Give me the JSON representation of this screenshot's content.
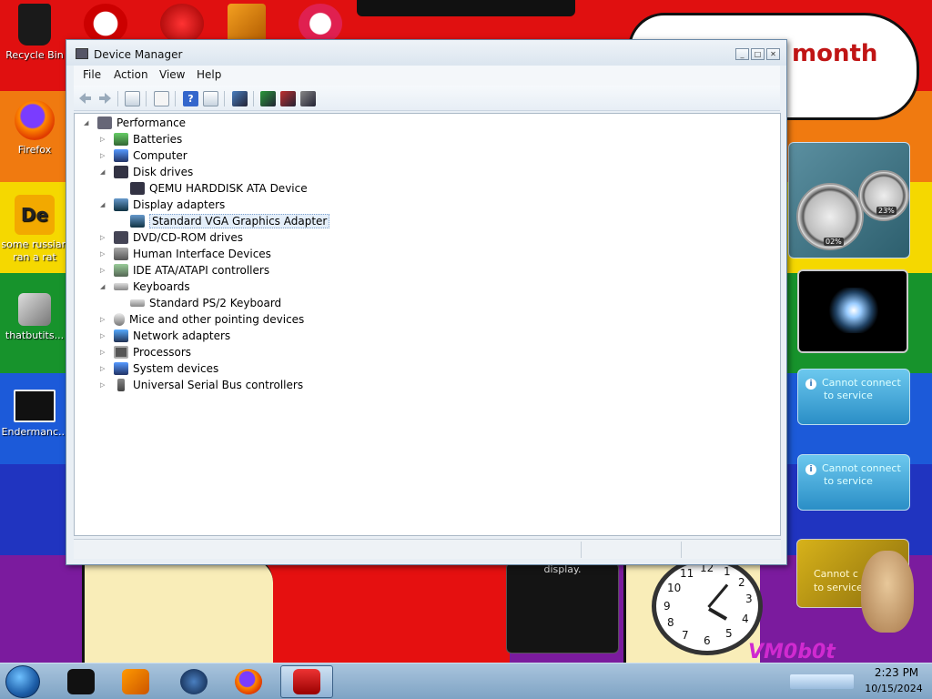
{
  "desktop": {
    "icons": [
      {
        "label": "Recycle Bin"
      },
      {
        "label": "Firefox"
      },
      {
        "label": "some russian ran a rat"
      },
      {
        "label": "thatbutits..."
      },
      {
        "label": "Endermanc..."
      }
    ],
    "bubble_text": "month"
  },
  "window": {
    "title": "Device Manager",
    "menu": [
      "File",
      "Action",
      "View",
      "Help"
    ],
    "tree": {
      "root": "Performance",
      "items": [
        {
          "label": "Batteries",
          "expanded": false
        },
        {
          "label": "Computer",
          "expanded": false
        },
        {
          "label": "Disk drives",
          "expanded": true,
          "children": [
            "QEMU HARDDISK ATA Device"
          ]
        },
        {
          "label": "Display adapters",
          "expanded": true,
          "children": [
            "Standard VGA Graphics Adapter"
          ],
          "selected_child": 0
        },
        {
          "label": "DVD/CD-ROM drives",
          "expanded": false
        },
        {
          "label": "Human Interface Devices",
          "expanded": false
        },
        {
          "label": "IDE ATA/ATAPI controllers",
          "expanded": false
        },
        {
          "label": "Keyboards",
          "expanded": true,
          "children": [
            "Standard PS/2 Keyboard"
          ]
        },
        {
          "label": "Mice and other pointing devices",
          "expanded": false
        },
        {
          "label": "Network adapters",
          "expanded": false
        },
        {
          "label": "Processors",
          "expanded": false
        },
        {
          "label": "System devices",
          "expanded": false
        },
        {
          "label": "Universal Serial Bus controllers",
          "expanded": false
        }
      ]
    }
  },
  "gadgets": {
    "meter_cpu": "02%",
    "meter_mem": "23%",
    "feed1": {
      "line1": "Cannot connect",
      "line2": "to service"
    },
    "feed2": {
      "line1": "Cannot connect",
      "line2": "to service"
    },
    "map": {
      "line1": "Cannot c",
      "line2": "to service"
    },
    "dark_text": "display.",
    "clock_numbers": [
      "9",
      "3",
      "4",
      "5",
      "6",
      "7",
      "8",
      "10",
      "11",
      "12",
      "1",
      "2"
    ],
    "vm_text": "VM0b0t"
  },
  "taskbar": {
    "time": "2:23 PM",
    "date": "10/15/2024"
  }
}
